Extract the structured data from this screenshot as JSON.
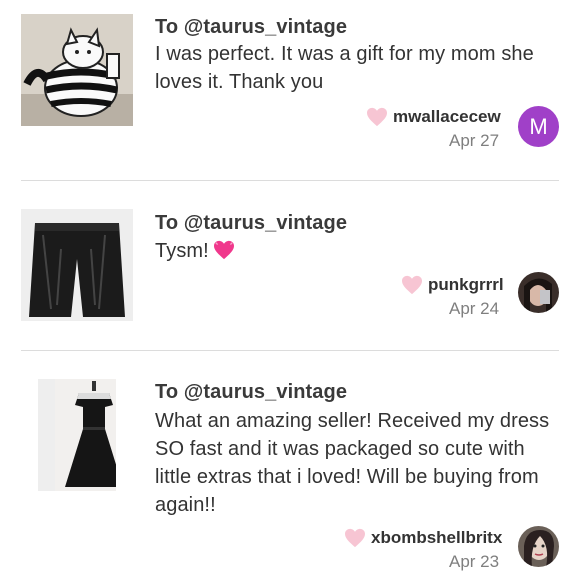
{
  "reviews": [
    {
      "to": "To @taurus_vintage",
      "message": "I was perfect. It was a gift for my mom she loves it. Thank you",
      "username": "mwallacecew",
      "date": "Apr 27",
      "avatar_letter": "M",
      "thumbnail": "cat-teapot-image",
      "avatar": "letter-avatar"
    },
    {
      "to": "To @taurus_vintage",
      "message": "Tysm!",
      "emoji": "pink-heart-emoji",
      "username": "punkgrrrl",
      "date": "Apr 24",
      "thumbnail": "black-pants-image",
      "avatar": "photo-avatar"
    },
    {
      "to": "To @taurus_vintage",
      "message": "What an amazing seller! Received my dress SO fast and it was packaged so cute with little extras that i loved! Will be buying from again!!",
      "username": "xbombshellbritx",
      "date": "Apr 23",
      "thumbnail": "black-dress-image",
      "avatar": "photo-avatar"
    }
  ],
  "colors": {
    "heart": "#f7c5d3",
    "avatar_purple": "#a040c8",
    "divider": "#dcdcdc",
    "date_gray": "#7f7f7f"
  }
}
